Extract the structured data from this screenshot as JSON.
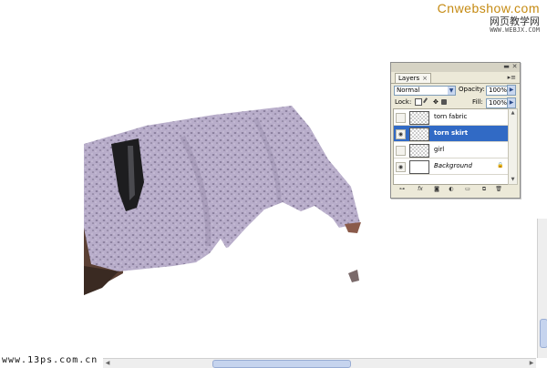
{
  "watermark_top": {
    "line1": "Cnwebshow.com",
    "line2": "网页教学网",
    "line3": "WWW.WEBJX.COM"
  },
  "watermark_bottom": "www.13ps.com.cn",
  "layers_panel": {
    "tab_label": "Layers",
    "tab_close": "×",
    "blend_mode": "Normal",
    "opacity_label": "Opacity:",
    "opacity_value": "100%",
    "lock_label": "Lock:",
    "fill_label": "Fill:",
    "fill_value": "100%",
    "layers": [
      {
        "name": "torn fabric",
        "visible": false,
        "selected": false
      },
      {
        "name": "torn skirt",
        "visible": true,
        "selected": true
      },
      {
        "name": "girl",
        "visible": false,
        "selected": false
      },
      {
        "name": "Background",
        "visible": true,
        "selected": false,
        "locked": true
      }
    ]
  },
  "colors": {
    "selected_layer": "#316ac5",
    "watermark_gold": "#c58a12",
    "fabric_lavender": "#b4a8c8"
  }
}
